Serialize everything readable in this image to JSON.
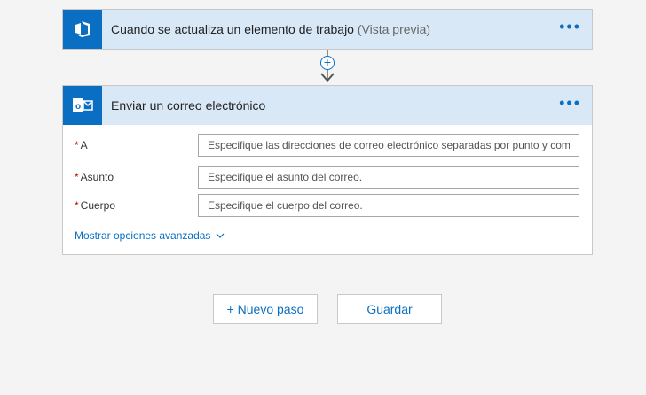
{
  "trigger": {
    "title": "Cuando se actualiza un elemento de trabajo",
    "title_suffix": "(Vista previa)",
    "icon": "vsts-icon",
    "more_label": "•••"
  },
  "connector": {
    "add_label": "+"
  },
  "action": {
    "title": "Enviar un correo electrónico",
    "icon": "outlook-icon",
    "more_label": "•••",
    "fields": [
      {
        "label": "A",
        "required": "*",
        "placeholder": "Especifique las direcciones de correo electrónico separadas por punto y com..."
      },
      {
        "label": "Asunto",
        "required": "*",
        "placeholder": "Especifique el asunto del correo."
      },
      {
        "label": "Cuerpo",
        "required": "*",
        "placeholder": "Especifique el cuerpo del correo."
      }
    ],
    "advanced_label": "Mostrar opciones avanzadas"
  },
  "buttons": {
    "new_step": "+ Nuevo paso",
    "save": "Guardar"
  },
  "colors": {
    "accent": "#0a6fc2",
    "header_bg": "#d9e8f7",
    "required": "#cc0000"
  }
}
